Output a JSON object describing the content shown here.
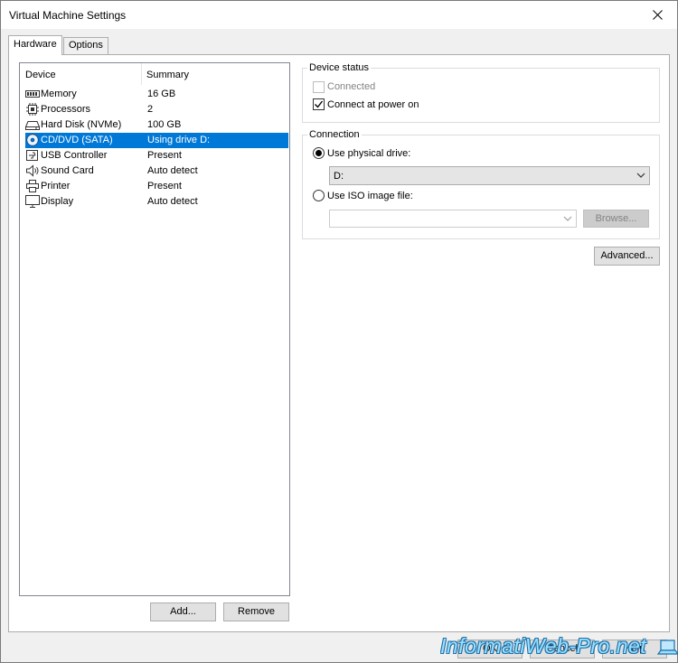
{
  "window": {
    "title": "Virtual Machine Settings"
  },
  "tabs": [
    {
      "label": "Hardware"
    },
    {
      "label": "Options"
    }
  ],
  "device_list": {
    "headers": {
      "device": "Device",
      "summary": "Summary"
    },
    "rows": [
      {
        "name": "Memory",
        "summary": "16 GB",
        "icon": "memory-icon"
      },
      {
        "name": "Processors",
        "summary": "2",
        "icon": "processor-icon"
      },
      {
        "name": "Hard Disk (NVMe)",
        "summary": "100 GB",
        "icon": "hard-disk-icon"
      },
      {
        "name": "CD/DVD (SATA)",
        "summary": "Using drive D:",
        "icon": "cd-dvd-icon",
        "selected": true
      },
      {
        "name": "USB Controller",
        "summary": "Present",
        "icon": "usb-icon"
      },
      {
        "name": "Sound Card",
        "summary": "Auto detect",
        "icon": "speaker-icon"
      },
      {
        "name": "Printer",
        "summary": "Present",
        "icon": "printer-icon"
      },
      {
        "name": "Display",
        "summary": "Auto detect",
        "icon": "monitor-icon"
      }
    ]
  },
  "list_buttons": {
    "add": "Add...",
    "remove": "Remove"
  },
  "device_status": {
    "title": "Device status",
    "connected": {
      "label": "Connected",
      "checked": false,
      "disabled": true
    },
    "connect_at_power_on": {
      "label": "Connect at power on",
      "checked": true
    }
  },
  "connection": {
    "title": "Connection",
    "use_physical_drive": {
      "label": "Use physical drive:",
      "selected": true
    },
    "physical_drive_value": "D:",
    "use_iso": {
      "label": "Use ISO image file:",
      "selected": false
    },
    "iso_value": "",
    "browse": "Browse..."
  },
  "advanced_button": "Advanced...",
  "footer": {
    "ok": "OK",
    "cancel": "Cancel",
    "help": "Help"
  },
  "watermark": "InformatiWeb-Pro.net",
  "colors": {
    "selection": "#0078d7",
    "watermark": "#9be1ff"
  }
}
